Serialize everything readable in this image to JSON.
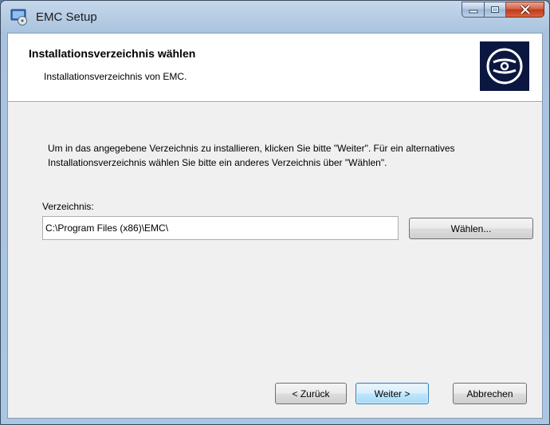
{
  "window": {
    "title": "EMC Setup",
    "app_icon": "setup-installer-icon",
    "caption_buttons": {
      "minimize_icon": "minimize-icon",
      "maximize_icon": "maximize-icon",
      "close_icon": "close-icon"
    }
  },
  "banner": {
    "title": "Installationsverzeichnis wählen",
    "subtitle": "Installationsverzeichnis von EMC.",
    "logo_icon": "disc-logo-icon"
  },
  "body": {
    "description": "Um in das angegebene Verzeichnis zu installieren, klicken Sie bitte \"Weiter\". Für ein alternatives Installationsverzeichnis wählen Sie bitte ein anderes Verzeichnis über \"Wählen\".",
    "directory_label": "Verzeichnis:",
    "directory_value": "C:\\Program Files (x86)\\EMC\\",
    "choose_button": "Wählen..."
  },
  "footer": {
    "back_button": "< Zurück",
    "next_button": "Weiter >",
    "cancel_button": "Abbrechen"
  },
  "colors": {
    "window_frame": "#aac6e2",
    "content_bg": "#f0f0f0",
    "banner_bg": "#ffffff",
    "logo_bg": "#0b1740",
    "close_button": "#c1381a",
    "default_button_border": "#3c7fb1"
  }
}
